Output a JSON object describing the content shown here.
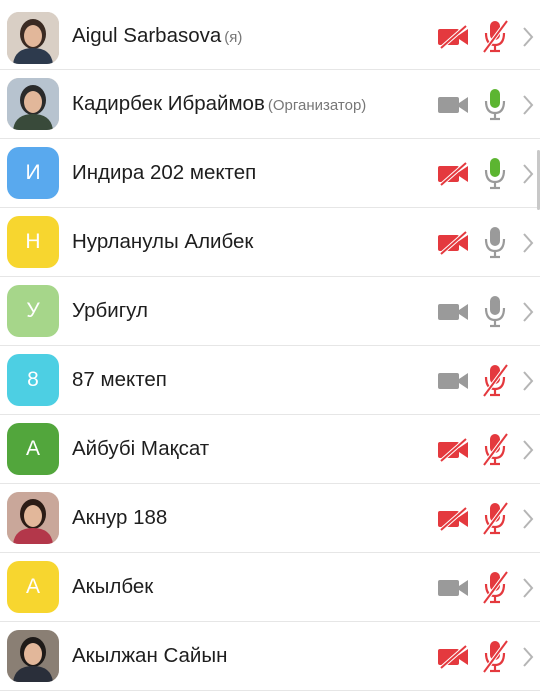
{
  "participants": [
    {
      "name": "Aigul Sarbasova",
      "role": "(я)",
      "avatar": {
        "type": "photo",
        "photo": "woman-portrait"
      },
      "video": "off",
      "audio": "muted"
    },
    {
      "name": "Кадирбек Ибраймов",
      "role": "(Организатор)",
      "avatar": {
        "type": "photo",
        "photo": "man-uniform-portrait"
      },
      "video": "on",
      "audio": "active"
    },
    {
      "name": "Индира 202 мектеп",
      "role": "",
      "avatar": {
        "type": "letter",
        "letter": "И",
        "color": "#59a9ee"
      },
      "video": "off",
      "audio": "active"
    },
    {
      "name": "Нурланулы Алибек",
      "role": "",
      "avatar": {
        "type": "letter",
        "letter": "Н",
        "color": "#f7d62f"
      },
      "video": "off",
      "audio": "on"
    },
    {
      "name": "Урбигул",
      "role": "",
      "avatar": {
        "type": "letter",
        "letter": "У",
        "color": "#a6d68a"
      },
      "video": "on",
      "audio": "on"
    },
    {
      "name": "87 мектеп",
      "role": "",
      "avatar": {
        "type": "letter",
        "letter": "8",
        "color": "#4dcfe3"
      },
      "video": "on",
      "audio": "muted"
    },
    {
      "name": "Айбубі Мақсат",
      "role": "",
      "avatar": {
        "type": "letter",
        "letter": "А",
        "color": "#52a63c"
      },
      "video": "off",
      "audio": "muted"
    },
    {
      "name": "Акнур 188",
      "role": "",
      "avatar": {
        "type": "photo",
        "photo": "girl-portrait"
      },
      "video": "off",
      "audio": "muted"
    },
    {
      "name": "Акылбек",
      "role": "",
      "avatar": {
        "type": "letter",
        "letter": "А",
        "color": "#f7d62f"
      },
      "video": "on",
      "audio": "muted"
    },
    {
      "name": "Акылжан Сайын",
      "role": "",
      "avatar": {
        "type": "photo",
        "photo": "man-suit-portrait"
      },
      "video": "off",
      "audio": "muted"
    }
  ],
  "colors": {
    "muted_red": "#e4393e",
    "icon_gray": "#9a9a9a",
    "active_green": "#5cb531",
    "chevron": "#b5b5b5"
  }
}
